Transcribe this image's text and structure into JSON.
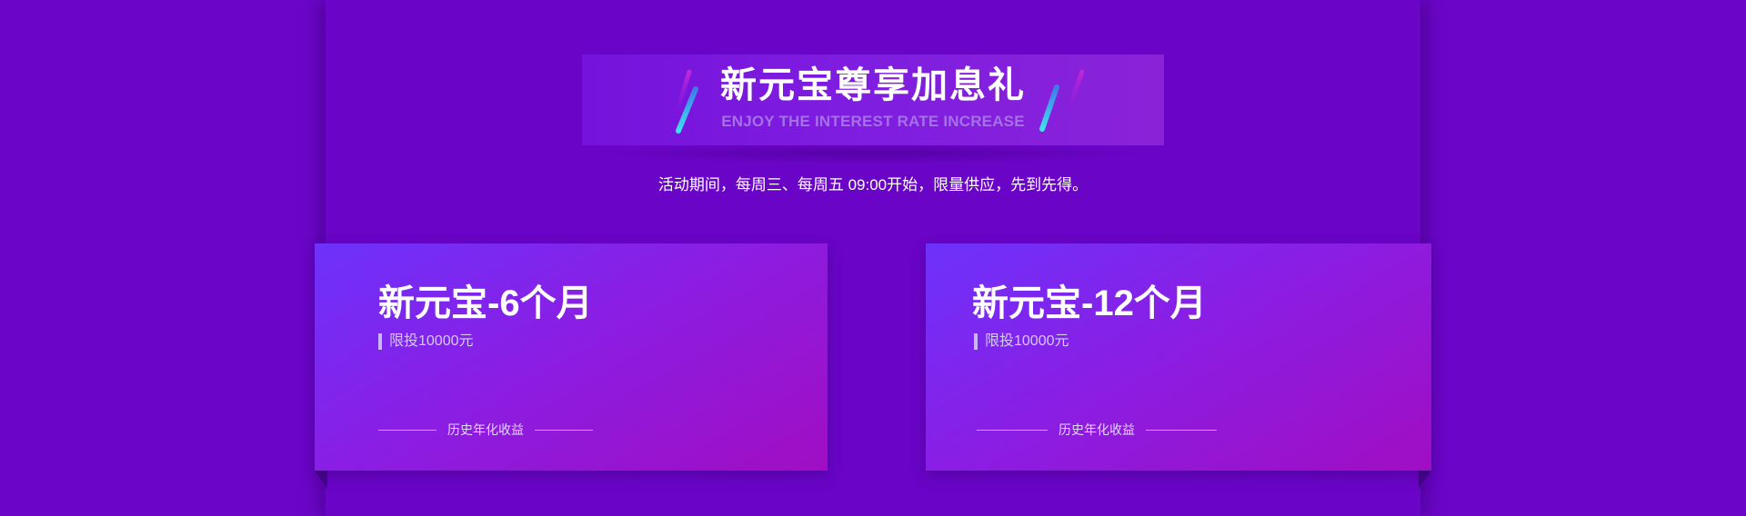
{
  "banner": {
    "title": "新元宝尊享加息礼",
    "subtitle": "ENJOY THE INTEREST RATE INCREASE"
  },
  "activity": {
    "info": "活动期间，每周三、每周五 09:00开始，限量供应，先到先得。"
  },
  "products": [
    {
      "name": "新元宝-6个月",
      "limit": "限投10000元",
      "yield_label": "历史年化收益"
    },
    {
      "name": "新元宝-12个月",
      "limit": "限投10000元",
      "yield_label": "历史年化收益"
    }
  ],
  "colors": {
    "background": "#6b06c8",
    "card_start": "#6d32fb",
    "card_end": "#a00ec2",
    "accent_cyan": "#3fd0ee",
    "accent_magenta": "#b41ec8"
  },
  "icons": {
    "left_decoration": "slash-decoration-icon",
    "right_decoration": "slash-decoration-icon"
  }
}
